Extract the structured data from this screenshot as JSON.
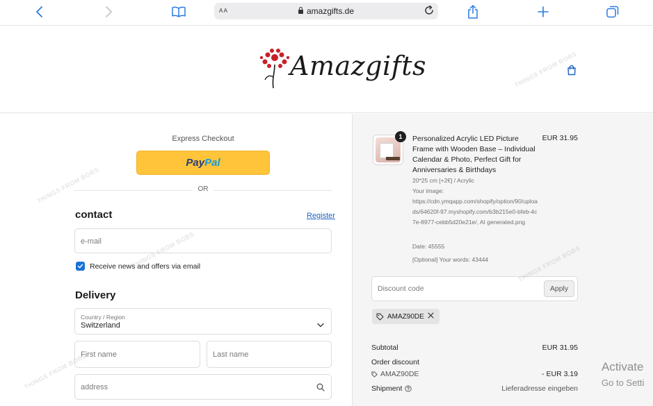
{
  "browser": {
    "address_prefix": "A A",
    "url": "amazgifts.de",
    "icons": [
      "back-icon",
      "forward-icon",
      "bookmarks-icon",
      "lock-icon",
      "reload-icon",
      "share-icon",
      "new-tab-icon",
      "tabs-icon"
    ]
  },
  "header": {
    "logo_text": "Amazgifts",
    "cart_icon": "shopping-bag-icon"
  },
  "checkout": {
    "express_label": "Express Checkout",
    "paypal_label_1": "Pay",
    "paypal_label_2": "Pal",
    "or_label": "OR",
    "contact_heading": "contact",
    "register_link": "Register",
    "email_placeholder": "e-mail",
    "newsletter_label": "Receive news and offers via email",
    "newsletter_checked": true,
    "delivery_heading": "Delivery",
    "country_label": "Country / Region",
    "country_value": "Switzerland",
    "first_name_placeholder": "First name",
    "last_name_placeholder": "Last name",
    "address_placeholder": "address"
  },
  "order": {
    "quantity": "1",
    "product_title": "Personalized Acrylic LED Picture Frame with Wooden Base – Individual Calendar & Photo, Perfect Gift for Anniversaries & Birthdays",
    "product_price": "EUR 31.95",
    "variant": "20*25 cm [+2€] / Acrylic",
    "image_label": "Your image:",
    "image_url": "https://cdn.ymqapp.com/shopify/option/90/uploads/64620f-97.myshopify.com/b3b215e0-bfeb-4c7e-8977-cebb5d20e21e/, AI generated.png",
    "date_line": "Date: 45555",
    "words_line": "[Optional] Your words: 43444",
    "discount_placeholder": "Discount code",
    "apply_label": "Apply",
    "applied_code": "AMAZ90DE",
    "subtotal_label": "Subtotal",
    "subtotal_value": "EUR 31.95",
    "order_discount_label": "Order discount",
    "discount_code_label": "AMAZ90DE",
    "discount_value": "- EUR 3.19",
    "shipment_label": "Shipment",
    "shipment_value": "Lieferadresse eingeben"
  },
  "overlay": {
    "watermark": "THINGS FROM BOBS",
    "activate_title": "Activate",
    "activate_sub": "Go to Setti"
  },
  "colors": {
    "paypal_yellow": "#ffc439",
    "paypal_dark_blue": "#253b80",
    "paypal_light_blue": "#179bd7",
    "link_blue": "#1a61c4",
    "checkbox_blue": "#1773d3",
    "logo_red": "#c8202a",
    "summary_bg": "#f5f5f5"
  }
}
